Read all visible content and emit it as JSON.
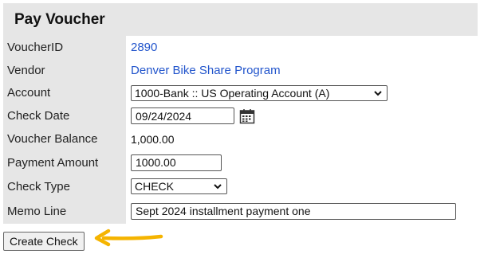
{
  "panel": {
    "title": "Pay Voucher"
  },
  "fields": {
    "voucher_id": {
      "label": "VoucherID",
      "value": "2890"
    },
    "vendor": {
      "label": "Vendor",
      "value": "Denver Bike Share Program"
    },
    "account": {
      "label": "Account",
      "value": "1000-Bank :: US Operating Account (A)"
    },
    "check_date": {
      "label": "Check Date",
      "value": "09/24/2024"
    },
    "voucher_balance": {
      "label": "Voucher Balance",
      "value": "1,000.00"
    },
    "payment_amount": {
      "label": "Payment Amount",
      "value": "1000.00"
    },
    "check_type": {
      "label": "Check Type",
      "value": "CHECK"
    },
    "memo_line": {
      "label": "Memo Line",
      "value": "Sept 2024 installment payment one"
    }
  },
  "actions": {
    "create_check_label": "Create Check"
  },
  "colors": {
    "panel_background": "#e6e6e6",
    "link": "#2255cc",
    "arrow": "#f5b400"
  },
  "icons": {
    "calendar": "calendar-icon",
    "dropdown": "chevron-down-icon",
    "pointer": "arrow-left-icon"
  }
}
